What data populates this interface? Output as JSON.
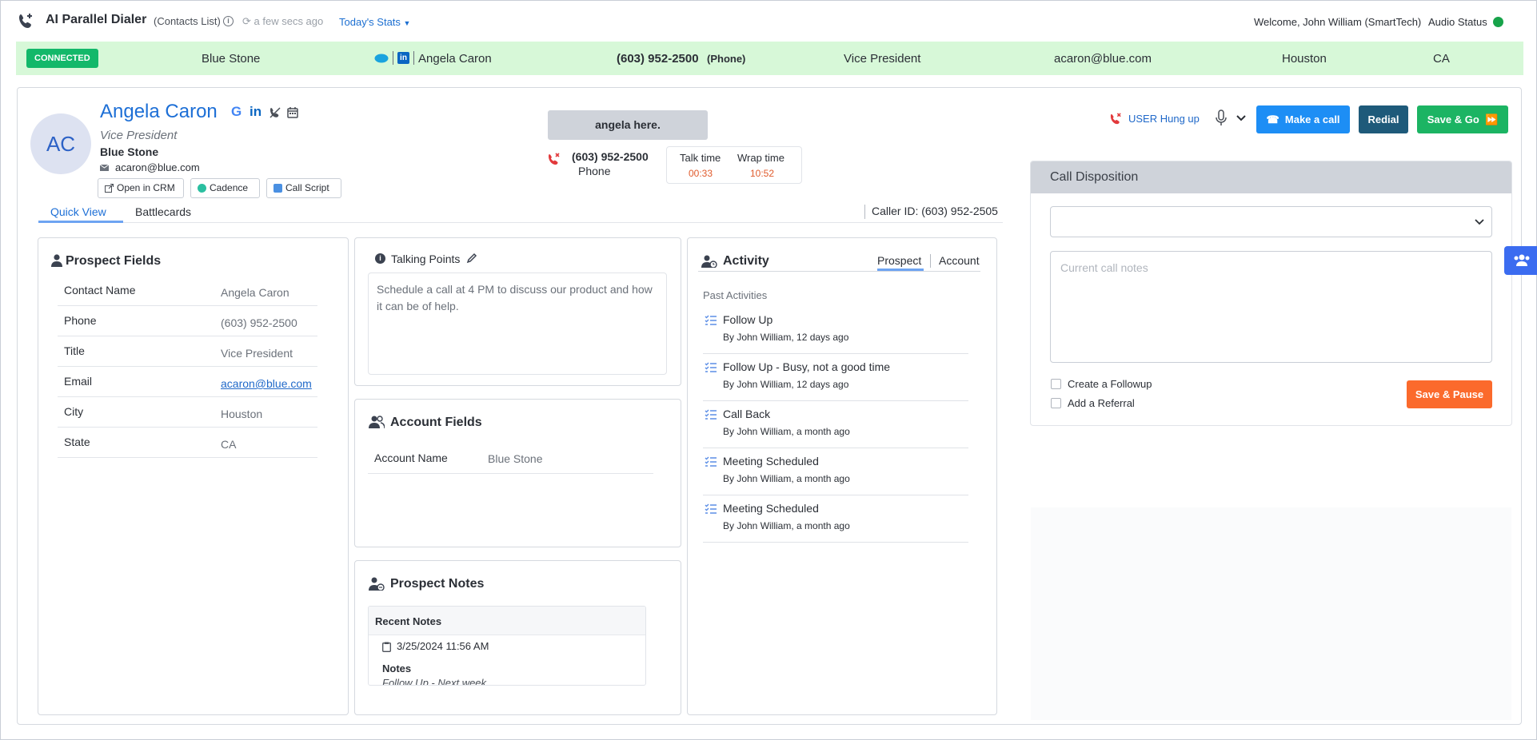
{
  "header": {
    "app_title": "AI Parallel Dialer",
    "list_label": "(Contacts List)",
    "refresh_text": "a few secs ago",
    "stats_label": "Today's Stats",
    "welcome": "Welcome, John William (SmartTech)",
    "audio_status": "Audio Status",
    "audio_status_color": "#17a34a"
  },
  "connected_bar": {
    "badge": "CONNECTED",
    "company": "Blue Stone",
    "contact_name": "Angela Caron",
    "phone": "(603) 952-2500",
    "phone_type": "(Phone)",
    "title": "Vice President",
    "email": "acaron@blue.com",
    "city": "Houston",
    "state": "CA"
  },
  "prospect": {
    "initials": "AC",
    "name": "Angela Caron",
    "title": "Vice President",
    "company": "Blue Stone",
    "email": "acaron@blue.com",
    "buttons": {
      "open_crm": "Open in CRM",
      "cadence": "Cadence",
      "call_script": "Call Script"
    }
  },
  "tabs": {
    "quick_view": "Quick View",
    "battlecards": "Battlecards"
  },
  "caller_id": "Caller ID: (603) 952-2505",
  "call": {
    "transcript_snippet": "angela here.",
    "phone": "(603) 952-2500",
    "phone_type": "Phone",
    "talk_time_label": "Talk time",
    "talk_time": "00:33",
    "wrap_time_label": "Wrap time",
    "wrap_time": "10:52"
  },
  "actions": {
    "hung_up": "USER Hung up",
    "make_call": "Make a call",
    "redial": "Redial",
    "save_go": "Save & Go"
  },
  "disposition": {
    "title": "Call Disposition",
    "notes_placeholder": "Current call notes",
    "create_followup": "Create a Followup",
    "add_referral": "Add a Referral",
    "save_pause": "Save & Pause"
  },
  "prospect_fields": {
    "title": "Prospect Fields",
    "rows": [
      {
        "label": "Contact Name",
        "value": "Angela Caron"
      },
      {
        "label": "Phone",
        "value": "(603) 952-2500"
      },
      {
        "label": "Title",
        "value": "Vice President"
      },
      {
        "label": "Email",
        "value": "acaron@blue.com"
      },
      {
        "label": "City",
        "value": "Houston"
      },
      {
        "label": "State",
        "value": "CA"
      }
    ]
  },
  "talking_points": {
    "title": "Talking Points",
    "text": "Schedule a call at 4 PM to discuss our product and how it can be of help."
  },
  "account_fields": {
    "title": "Account Fields",
    "rows": [
      {
        "label": "Account Name",
        "value": "Blue Stone"
      }
    ]
  },
  "prospect_notes": {
    "title": "Prospect Notes",
    "recent_label": "Recent Notes",
    "date": "3/25/2024 11:56 AM",
    "notes_label": "Notes",
    "note_text": "Follow Up - Next week"
  },
  "activity": {
    "title": "Activity",
    "tab_prospect": "Prospect",
    "tab_account": "Account",
    "past_label": "Past Activities",
    "items": [
      {
        "title": "Follow Up",
        "sub": "By John William, 12 days ago"
      },
      {
        "title": "Follow Up - Busy, not a good time",
        "sub": "By John William, 12 days ago"
      },
      {
        "title": "Call Back",
        "sub": "By John William, a month ago"
      },
      {
        "title": "Meeting Scheduled",
        "sub": "By John William, a month ago"
      },
      {
        "title": "Meeting Scheduled",
        "sub": "By John William, a month ago"
      }
    ]
  },
  "colors": {
    "accent": "#1d6fd6",
    "connected_bg": "#d7f8d8",
    "save_go": "#1cb463",
    "save_pause": "#fb6a2c"
  }
}
